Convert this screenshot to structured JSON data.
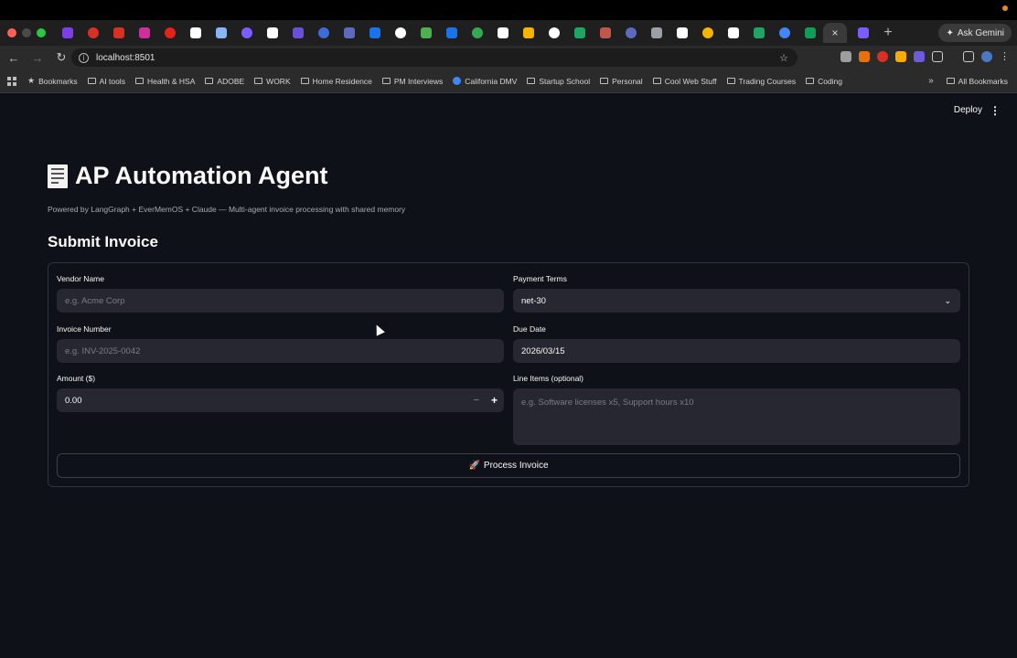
{
  "browser": {
    "tab_close_glyph": "×",
    "new_tab_glyph": "+",
    "gemini_label": "Ask Gemini",
    "url": "localhost:8501",
    "tab_favicon_colors": [
      "#7b3fe4",
      "#d93025",
      "#d93025",
      "#cf2e9b",
      "#e62117",
      "#ffffff",
      "#8ab4f8",
      "#7c5cff",
      "#ffffff",
      "#6b4fd8",
      "#3f6bd8",
      "#5c6bc0",
      "#1a73e8",
      "#ffffff",
      "#4caf50",
      "#1a73e8",
      "#34a853",
      "#ffffff",
      "#f4b400",
      "#ffffff",
      "#1fa463",
      "#c0574c",
      "#5c6bc0",
      "#9aa0a6",
      "#ffffff",
      "#f4b400",
      "#ffffff",
      "#1fa463",
      "#4285f4",
      "#0f9d58"
    ]
  },
  "bookmarks": {
    "items": [
      "Bookmarks",
      "AI tools",
      "Health & HSA",
      "ADOBE",
      "WORK",
      "Home Residence",
      "PM Interviews",
      "California DMV",
      "Startup School",
      "Personal",
      "Cool Web Stuff",
      "Trading Courses",
      "Coding"
    ],
    "more_glyph": "»",
    "all_bookmarks": "All Bookmarks"
  },
  "app": {
    "deploy_label": "Deploy",
    "menu_glyph": "⋮",
    "title": "AP Automation Agent",
    "subtitle": "Powered by LangGraph + EverMemOS + Claude — Multi-agent invoice processing with shared memory",
    "section_title": "Submit Invoice"
  },
  "form": {
    "vendor_label": "Vendor Name",
    "vendor_placeholder": "e.g. Acme Corp",
    "invoice_label": "Invoice Number",
    "invoice_placeholder": "e.g. INV-2025-0042",
    "amount_label": "Amount ($)",
    "amount_value": "0.00",
    "minus_glyph": "−",
    "plus_glyph": "+",
    "terms_label": "Payment Terms",
    "terms_value": "net-30",
    "due_label": "Due Date",
    "due_value": "2026/03/15",
    "items_label": "Line Items (optional)",
    "items_placeholder": "e.g. Software licenses x5, Support hours x10",
    "submit_label": "Process Invoice",
    "submit_emoji": "🚀"
  }
}
